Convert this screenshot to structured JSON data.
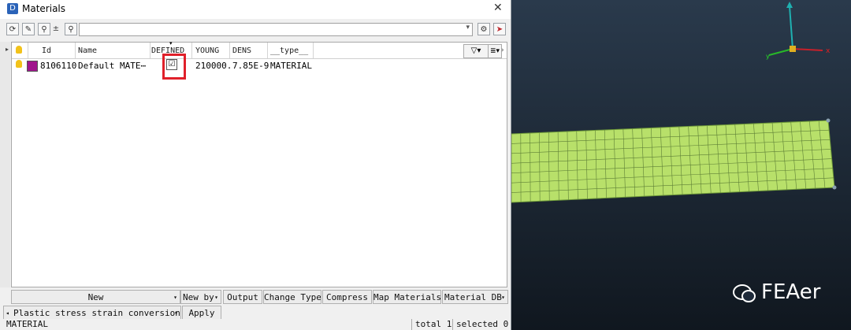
{
  "window": {
    "title": "Materials",
    "close_glyph": "✕",
    "app_icon_letter": "D"
  },
  "toolbar": {
    "buttons": [
      {
        "name": "refresh-icon",
        "glyph": "⟳"
      },
      {
        "name": "pick-icon",
        "glyph": "✎"
      },
      {
        "name": "zoom-icon",
        "glyph": "⚲"
      },
      {
        "name": "plus-minus-icon",
        "glyph": "±"
      },
      {
        "name": "search-icon",
        "glyph": "⚲"
      }
    ],
    "search_value": "",
    "settings_glyph": "⚙",
    "pointer_glyph": "➤"
  },
  "table": {
    "headers": [
      "Id",
      "Name",
      "DEFINED",
      "YOUNG",
      "DENS",
      "__type__"
    ],
    "rows": [
      {
        "id": "8106110",
        "name": "Default MATE⋯",
        "defined": "☑",
        "young": "210000.",
        "dens": "7.85E-9",
        "type": "MATERIAL"
      }
    ],
    "filter_glyph": "▽▾",
    "columns_glyph": "≣▾",
    "more_glyph": "›",
    "accent_swatch": "#a0148c"
  },
  "buttons_row1": {
    "new": "New",
    "new_by": "New by",
    "output": "Output",
    "change_type": "Change Type",
    "compress": "Compress",
    "map_materials": "Map Materials",
    "material_db": "Material DB"
  },
  "buttons_row2": {
    "conversion": "Plastic stress strain conversion",
    "apply": "Apply"
  },
  "status": {
    "type": "MATERIAL",
    "total": "total 1",
    "selected": "selected 0"
  },
  "viewport": {
    "logo_text": "FEAer",
    "mesh_color": "#b8e06a",
    "axis_x_label": "x"
  }
}
